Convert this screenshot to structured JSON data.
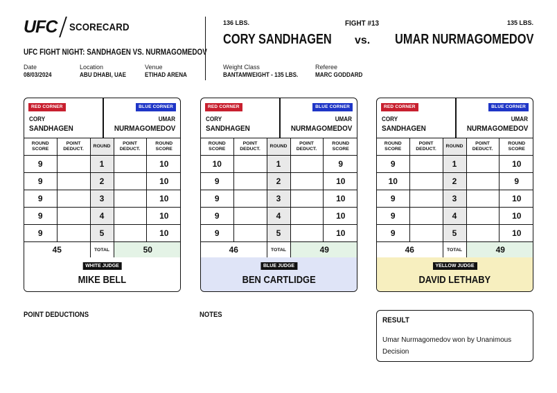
{
  "header": {
    "logo": "UFC",
    "title": "SCORECARD",
    "event": "UFC FIGHT NIGHT: SANDHAGEN VS. NURMAGOMEDOV",
    "date_label": "Date",
    "date": "08/03/2024",
    "location_label": "Location",
    "location": "ABU DHABI, UAE",
    "venue_label": "Venue",
    "venue": "ETIHAD ARENA"
  },
  "fight": {
    "number": "FIGHT #13",
    "red_weight": "136 LBS.",
    "blue_weight": "135 LBS.",
    "red_name": "CORY SANDHAGEN",
    "blue_name": "UMAR NURMAGOMEDOV",
    "vs": "vs.",
    "weight_class_label": "Weight Class",
    "weight_class": "BANTAMWEIGHT - 135 LBS.",
    "referee_label": "Referee",
    "referee": "MARC GODDARD"
  },
  "labels": {
    "red_corner": "RED CORNER",
    "blue_corner": "BLUE CORNER",
    "round_score": "ROUND SCORE",
    "point_deduct": "POINT DEDUCT.",
    "round": "ROUND",
    "total": "TOTAL"
  },
  "red_first": "CORY",
  "red_last": "SANDHAGEN",
  "blue_first": "UMAR",
  "blue_last": "NURMAGOMEDOV",
  "cards": [
    {
      "judge_badge": "WHITE JUDGE",
      "judge_name": "MIKE BELL",
      "bg": "#ffffff",
      "rows": [
        {
          "red": "9",
          "red_ded": "",
          "round": "1",
          "blue_ded": "",
          "blue": "10"
        },
        {
          "red": "9",
          "red_ded": "",
          "round": "2",
          "blue_ded": "",
          "blue": "10"
        },
        {
          "red": "9",
          "red_ded": "",
          "round": "3",
          "blue_ded": "",
          "blue": "10"
        },
        {
          "red": "9",
          "red_ded": "",
          "round": "4",
          "blue_ded": "",
          "blue": "10"
        },
        {
          "red": "9",
          "red_ded": "",
          "round": "5",
          "blue_ded": "",
          "blue": "10"
        }
      ],
      "red_total": "45",
      "blue_total": "50"
    },
    {
      "judge_badge": "BLUE JUDGE",
      "judge_name": "BEN CARTLIDGE",
      "bg": "#dfe4f7",
      "rows": [
        {
          "red": "10",
          "red_ded": "",
          "round": "1",
          "blue_ded": "",
          "blue": "9"
        },
        {
          "red": "9",
          "red_ded": "",
          "round": "2",
          "blue_ded": "",
          "blue": "10"
        },
        {
          "red": "9",
          "red_ded": "",
          "round": "3",
          "blue_ded": "",
          "blue": "10"
        },
        {
          "red": "9",
          "red_ded": "",
          "round": "4",
          "blue_ded": "",
          "blue": "10"
        },
        {
          "red": "9",
          "red_ded": "",
          "round": "5",
          "blue_ded": "",
          "blue": "10"
        }
      ],
      "red_total": "46",
      "blue_total": "49"
    },
    {
      "judge_badge": "YELLOW JUDGE",
      "judge_name": "DAVID LETHABY",
      "bg": "#f7efbf",
      "rows": [
        {
          "red": "9",
          "red_ded": "",
          "round": "1",
          "blue_ded": "",
          "blue": "10"
        },
        {
          "red": "10",
          "red_ded": "",
          "round": "2",
          "blue_ded": "",
          "blue": "9"
        },
        {
          "red": "9",
          "red_ded": "",
          "round": "3",
          "blue_ded": "",
          "blue": "10"
        },
        {
          "red": "9",
          "red_ded": "",
          "round": "4",
          "blue_ded": "",
          "blue": "10"
        },
        {
          "red": "9",
          "red_ded": "",
          "round": "5",
          "blue_ded": "",
          "blue": "10"
        }
      ],
      "red_total": "46",
      "blue_total": "49"
    }
  ],
  "bottom": {
    "point_deductions_label": "POINT DEDUCTIONS",
    "notes_label": "NOTES",
    "result_label": "RESULT",
    "result_text": "Umar Nurmagomedov won by Unanimous Decision"
  },
  "colors": {
    "red_corner": "#c8202f",
    "blue_corner": "#1f36c7",
    "winner_total_bg": "#e4f3e6"
  }
}
